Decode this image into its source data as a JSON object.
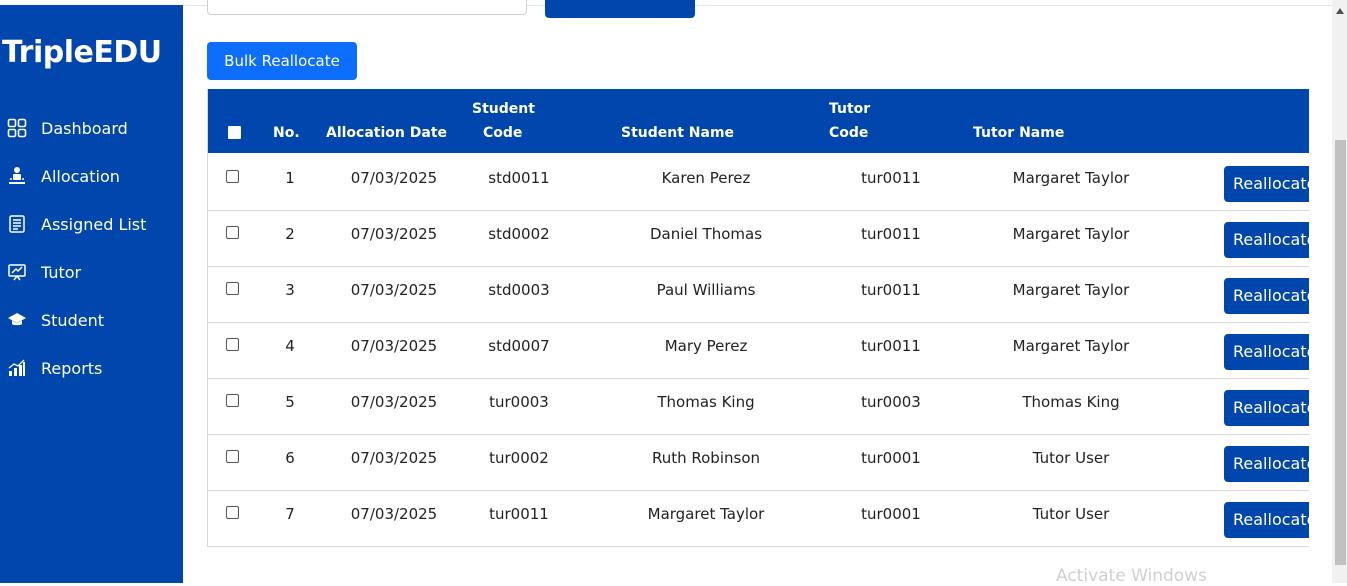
{
  "sidebar": {
    "brand": "TripleEDU",
    "items": [
      {
        "label": "Dashboard",
        "icon": "dashboard-icon"
      },
      {
        "label": "Allocation",
        "icon": "allocation-icon"
      },
      {
        "label": "Assigned List",
        "icon": "list-icon"
      },
      {
        "label": "Tutor",
        "icon": "tutor-icon"
      },
      {
        "label": "Student",
        "icon": "graduation-cap-icon"
      },
      {
        "label": "Reports",
        "icon": "chart-icon"
      }
    ]
  },
  "toolbar": {
    "bulk_label": "Bulk Reallocate"
  },
  "table": {
    "headers": {
      "no": "No.",
      "date": "Allocation Date",
      "student_code_1": "Student",
      "student_code_2": "Code",
      "student_name": "Student Name",
      "tutor_code_1": "Tutor",
      "tutor_code_2": "Code",
      "tutor_name": "Tutor Name"
    },
    "action_label": "Reallocate",
    "rows": [
      {
        "no": "1",
        "date": "07/03/2025",
        "student_code": "std0011",
        "student_name": "Karen Perez",
        "tutor_code": "tur0011",
        "tutor_name": "Margaret Taylor"
      },
      {
        "no": "2",
        "date": "07/03/2025",
        "student_code": "std0002",
        "student_name": "Daniel Thomas",
        "tutor_code": "tur0011",
        "tutor_name": "Margaret Taylor"
      },
      {
        "no": "3",
        "date": "07/03/2025",
        "student_code": "std0003",
        "student_name": "Paul Williams",
        "tutor_code": "tur0011",
        "tutor_name": "Margaret Taylor"
      },
      {
        "no": "4",
        "date": "07/03/2025",
        "student_code": "std0007",
        "student_name": "Mary Perez",
        "tutor_code": "tur0011",
        "tutor_name": "Margaret Taylor"
      },
      {
        "no": "5",
        "date": "07/03/2025",
        "student_code": "tur0003",
        "student_name": "Thomas King",
        "tutor_code": "tur0003",
        "tutor_name": "Thomas King"
      },
      {
        "no": "6",
        "date": "07/03/2025",
        "student_code": "tur0002",
        "student_name": "Ruth Robinson",
        "tutor_code": "tur0001",
        "tutor_name": "Tutor User"
      },
      {
        "no": "7",
        "date": "07/03/2025",
        "student_code": "tur0011",
        "student_name": "Margaret Taylor",
        "tutor_code": "tur0001",
        "tutor_name": "Tutor User"
      }
    ]
  },
  "watermark": "Activate Windows",
  "colors": {
    "sidebar": "#0046ad",
    "primary_button": "#0d6efd",
    "header": "#0046ad"
  }
}
